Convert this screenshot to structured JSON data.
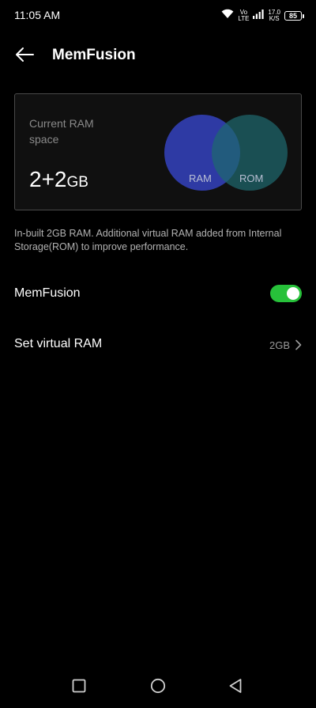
{
  "status_bar": {
    "time": "11:05 AM",
    "network_type_top": "Vo",
    "network_type_bottom": "LTE",
    "speed_value": "17.0",
    "speed_unit": "K/S",
    "battery": "85",
    "icons": [
      "wifi-icon",
      "signal-icon",
      "battery-icon"
    ]
  },
  "app_bar": {
    "title": "MemFusion",
    "back_icon": "arrow-left-icon"
  },
  "ram_card": {
    "label": "Current RAM space",
    "value": "2+2",
    "unit": "GB",
    "venn": {
      "ram_label": "RAM",
      "rom_label": "ROM",
      "ram_color": "#3442BE",
      "rom_color": "#1E686E"
    }
  },
  "description": "In-built 2GB RAM. Additional virtual RAM added from Internal Storage(ROM) to improve performance.",
  "settings": {
    "memfusion": {
      "label": "MemFusion",
      "enabled": true,
      "toggle_color": "#27C13A"
    },
    "virtual_ram": {
      "label": "Set virtual RAM",
      "value": "2GB"
    }
  },
  "nav_bar": {
    "icons": [
      "square-recents-icon",
      "circle-home-icon",
      "triangle-back-icon"
    ]
  }
}
